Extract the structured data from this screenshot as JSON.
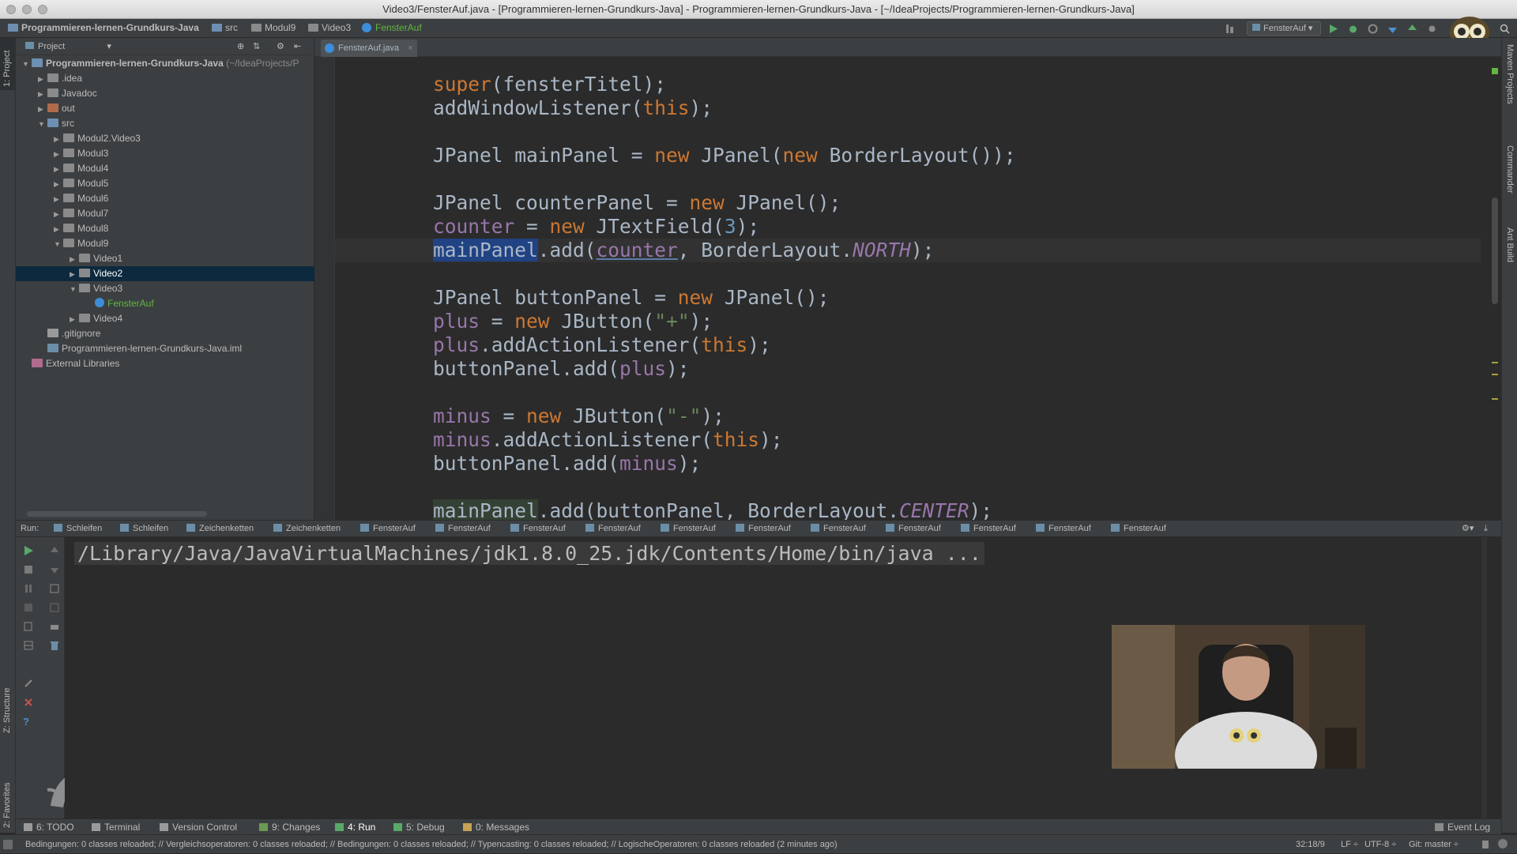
{
  "window": {
    "title": "Video3/FensterAuf.java - [Programmieren-lernen-Grundkurs-Java] - Programmieren-lernen-Grundkurs-Java - [~/IdeaProjects/Programmieren-lernen-Grundkurs-Java]"
  },
  "breadcrumb": [
    "Programmieren-lernen-Grundkurs-Java",
    "src",
    "Modul9",
    "Video3",
    "FensterAuf"
  ],
  "toolbar": {
    "run_config": "FensterAuf"
  },
  "left_strip": {
    "project_tab": "1: Project",
    "structure_tab": "Z: Structure",
    "favorites_tab": "2: Favorites"
  },
  "right_strip": {
    "maven_tab": "Maven Projects",
    "commander_tab": "Commander",
    "ant_tab": "Ant Build"
  },
  "project": {
    "header": "Project",
    "tree": [
      {
        "label": "Programmieren-lernen-Grundkurs-Java",
        "suffix": " (~/IdeaProjects/P",
        "depth": 0,
        "arrow": "▼",
        "kind": "module",
        "bold": true
      },
      {
        "label": ".idea",
        "depth": 1,
        "arrow": "▶",
        "kind": "folder"
      },
      {
        "label": "Javadoc",
        "depth": 1,
        "arrow": "▶",
        "kind": "folder"
      },
      {
        "label": "out",
        "depth": 1,
        "arrow": "▶",
        "kind": "folder-out"
      },
      {
        "label": "src",
        "depth": 1,
        "arrow": "▼",
        "kind": "folder-src"
      },
      {
        "label": "Modul2.Video3",
        "depth": 2,
        "arrow": "▶",
        "kind": "package"
      },
      {
        "label": "Modul3",
        "depth": 2,
        "arrow": "▶",
        "kind": "package"
      },
      {
        "label": "Modul4",
        "depth": 2,
        "arrow": "▶",
        "kind": "package"
      },
      {
        "label": "Modul5",
        "depth": 2,
        "arrow": "▶",
        "kind": "package"
      },
      {
        "label": "Modul6",
        "depth": 2,
        "arrow": "▶",
        "kind": "package"
      },
      {
        "label": "Modul7",
        "depth": 2,
        "arrow": "▶",
        "kind": "package"
      },
      {
        "label": "Modul8",
        "depth": 2,
        "arrow": "▶",
        "kind": "package"
      },
      {
        "label": "Modul9",
        "depth": 2,
        "arrow": "▼",
        "kind": "package"
      },
      {
        "label": "Video1",
        "depth": 3,
        "arrow": "▶",
        "kind": "package"
      },
      {
        "label": "Video2",
        "depth": 3,
        "arrow": "▶",
        "kind": "package",
        "selected": true
      },
      {
        "label": "Video3",
        "depth": 3,
        "arrow": "▼",
        "kind": "package"
      },
      {
        "label": "FensterAuf",
        "depth": 4,
        "arrow": "",
        "kind": "class"
      },
      {
        "label": "Video4",
        "depth": 3,
        "arrow": "▶",
        "kind": "package"
      },
      {
        "label": ".gitignore",
        "depth": 1,
        "arrow": "",
        "kind": "file"
      },
      {
        "label": "Programmieren-lernen-Grundkurs-Java.iml",
        "depth": 1,
        "arrow": "",
        "kind": "iml"
      },
      {
        "label": "External Libraries",
        "depth": 0,
        "arrow": "",
        "kind": "libs"
      }
    ]
  },
  "editor": {
    "tab_label": "FensterAuf.java",
    "lines": [
      [
        [
          "super",
          "kw"
        ],
        [
          "(fensterTitel);",
          ""
        ]
      ],
      [
        [
          "addWindowListener(",
          ""
        ],
        [
          "this",
          "kw"
        ],
        [
          ");",
          ""
        ]
      ],
      [],
      [
        [
          "JPanel mainPanel = ",
          ""
        ],
        [
          "new",
          "kw"
        ],
        [
          " JPanel(",
          ""
        ],
        [
          "new",
          "kw"
        ],
        [
          " BorderLayout());",
          ""
        ]
      ],
      [],
      [
        [
          "JPanel counterPanel = ",
          ""
        ],
        [
          "new",
          "kw"
        ],
        [
          " JPanel();",
          ""
        ]
      ],
      [
        [
          "counter",
          "fld"
        ],
        [
          " = ",
          ""
        ],
        [
          "new",
          "kw"
        ],
        [
          " JTextField(",
          ""
        ],
        [
          "3",
          "num"
        ],
        [
          ");",
          ""
        ]
      ],
      [
        [
          "mainPanel",
          "sel"
        ],
        [
          ".add(",
          ""
        ],
        [
          "counter",
          "fldu"
        ],
        [
          ", BorderLayout.",
          ""
        ],
        [
          "NORTH",
          "fldi"
        ],
        [
          ");",
          ""
        ]
      ],
      [],
      [
        [
          "JPanel buttonPanel = ",
          ""
        ],
        [
          "new",
          "kw"
        ],
        [
          " JPanel();",
          ""
        ]
      ],
      [
        [
          "plus",
          "fld"
        ],
        [
          " = ",
          ""
        ],
        [
          "new",
          "kw"
        ],
        [
          " JButton(",
          ""
        ],
        [
          "\"+\"",
          "str"
        ],
        [
          ");",
          ""
        ]
      ],
      [
        [
          "plus",
          "fld"
        ],
        [
          ".addActionListener(",
          ""
        ],
        [
          "this",
          "kw"
        ],
        [
          ");",
          ""
        ]
      ],
      [
        [
          "buttonPanel.add(",
          ""
        ],
        [
          "plus",
          "fld"
        ],
        [
          ");",
          ""
        ]
      ],
      [],
      [
        [
          "minus",
          "fld"
        ],
        [
          " = ",
          ""
        ],
        [
          "new",
          "kw"
        ],
        [
          " JButton(",
          ""
        ],
        [
          "\"-\"",
          "str"
        ],
        [
          ");",
          ""
        ]
      ],
      [
        [
          "minus",
          "fld"
        ],
        [
          ".addActionListener(",
          ""
        ],
        [
          "this",
          "kw"
        ],
        [
          ");",
          ""
        ]
      ],
      [
        [
          "buttonPanel.add(",
          ""
        ],
        [
          "minus",
          "fld"
        ],
        [
          ");",
          ""
        ]
      ],
      [],
      [
        [
          "mainPanel",
          "hl"
        ],
        [
          ".add(buttonPanel, BorderLayout.",
          ""
        ],
        [
          "CENTER",
          "fldi"
        ],
        [
          ");",
          ""
        ]
      ]
    ]
  },
  "run": {
    "label": "Run:",
    "tabs": [
      "Schleifen",
      "Schleifen",
      "Zeichenketten",
      "Zeichenketten",
      "FensterAuf",
      "FensterAuf",
      "FensterAuf",
      "FensterAuf",
      "FensterAuf",
      "FensterAuf",
      "FensterAuf",
      "FensterAuf",
      "FensterAuf",
      "FensterAuf",
      "FensterAuf"
    ],
    "console_line": "/Library/Java/JavaVirtualMachines/jdk1.8.0_25.jdk/Contents/Home/bin/java ..."
  },
  "bottom_tabs": [
    {
      "label": "6: TODO",
      "icon": "todo-icon",
      "color": "#9a9a9a"
    },
    {
      "label": "Terminal",
      "icon": "terminal-icon",
      "color": "#9a9a9a"
    },
    {
      "label": "Version Control",
      "icon": "version-control-icon",
      "color": "#9a9a9a"
    },
    {
      "label": "9: Changes",
      "icon": "changes-icon",
      "color": "#6a9955"
    },
    {
      "label": "4: Run",
      "icon": "run-icon",
      "color": "#59a869",
      "active": true
    },
    {
      "label": "5: Debug",
      "icon": "debug-icon",
      "color": "#59a869"
    },
    {
      "label": "0: Messages",
      "icon": "messages-icon",
      "color": "#c7a255"
    }
  ],
  "event_log": "Event Log",
  "status": {
    "message": "Bedingungen: 0 classes reloaded; // Vergleichsoperatoren: 0 classes reloaded; // Bedingungen: 0 classes reloaded; // Typencasting: 0 classes reloaded; // LogischeOperatoren: 0 classes reloaded (2 minutes ago)",
    "position": "32:18/9",
    "line_sep": "LF ÷",
    "encoding": "UTF-8 ÷",
    "vcs": "Git: master ÷"
  },
  "colors": {
    "keyword": "#cc7832",
    "field": "#9876aa",
    "string": "#6a8759",
    "number": "#6897bb",
    "selection": "#0d293e"
  }
}
